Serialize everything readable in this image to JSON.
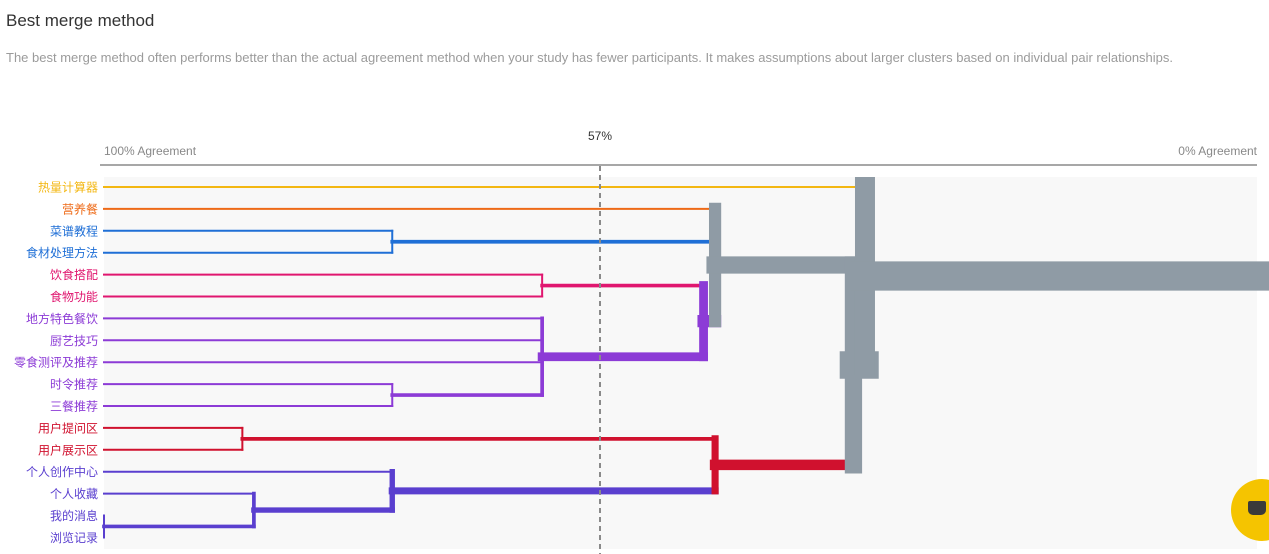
{
  "header": {
    "title": "Best merge method",
    "description": "The best merge method often performs better than the actual agreement method when your study has fewer participants. It makes assumptions about larger clusters based on individual pair relationships."
  },
  "chart_data": {
    "type": "dendrogram",
    "axis": {
      "left_label": "100% Agreement",
      "right_label": "0% Agreement"
    },
    "threshold": {
      "label": "57%",
      "value": 57
    },
    "leaves": [
      {
        "id": "L0",
        "label": "热量计算器",
        "color": "#f3b712"
      },
      {
        "id": "L1",
        "label": "营养餐",
        "color": "#ee6a17"
      },
      {
        "id": "L2",
        "label": "菜谱教程",
        "color": "#1f6fd6"
      },
      {
        "id": "L3",
        "label": "食材处理方法",
        "color": "#1f6fd6"
      },
      {
        "id": "L4",
        "label": "饮食搭配",
        "color": "#e0166f"
      },
      {
        "id": "L5",
        "label": "食物功能",
        "color": "#e0166f"
      },
      {
        "id": "L6",
        "label": "地方特色餐饮",
        "color": "#8c3bd6"
      },
      {
        "id": "L7",
        "label": "厨艺技巧",
        "color": "#8c3bd6"
      },
      {
        "id": "L8",
        "label": "零食测评及推荐",
        "color": "#8c3bd6"
      },
      {
        "id": "L9",
        "label": "时令推荐",
        "color": "#8c3bd6"
      },
      {
        "id": "L10",
        "label": "三餐推荐",
        "color": "#8c3bd6"
      },
      {
        "id": "L11",
        "label": "用户提问区",
        "color": "#d0112e"
      },
      {
        "id": "L12",
        "label": "用户展示区",
        "color": "#d0112e"
      },
      {
        "id": "L13",
        "label": "个人创作中心",
        "color": "#5a3fcf"
      },
      {
        "id": "L14",
        "label": "个人收藏",
        "color": "#5a3fcf"
      },
      {
        "id": "L15",
        "label": "我的消息",
        "color": "#5a3fcf"
      },
      {
        "id": "L16",
        "label": "浏览记录",
        "color": "#5a3fcf"
      }
    ],
    "merges": [
      {
        "id": "A",
        "children": [
          "L15",
          "L16"
        ],
        "agreement": 100,
        "color": "#5a3fcf"
      },
      {
        "id": "B",
        "children": [
          "L14",
          "A"
        ],
        "agreement": 87,
        "color": "#5a3fcf"
      },
      {
        "id": "C",
        "children": [
          "L13",
          "B"
        ],
        "agreement": 75,
        "color": "#5a3fcf"
      },
      {
        "id": "D",
        "children": [
          "L11",
          "L12"
        ],
        "agreement": 88,
        "color": "#d0112e"
      },
      {
        "id": "E",
        "children": [
          "D",
          "C"
        ],
        "agreement": 47,
        "color": "#d0112e"
      },
      {
        "id": "F",
        "children": [
          "L9",
          "L10"
        ],
        "agreement": 75,
        "color": "#8c3bd6"
      },
      {
        "id": "G",
        "children": [
          "L6",
          "L7",
          "L8",
          "F"
        ],
        "agreement": 62,
        "color": "#8c3bd6"
      },
      {
        "id": "H",
        "children": [
          "L4",
          "L5"
        ],
        "agreement": 62,
        "color": "#e0166f"
      },
      {
        "id": "I",
        "children": [
          "H",
          "G"
        ],
        "agreement": 48,
        "color": "#8c3bd6"
      },
      {
        "id": "J",
        "children": [
          "L2",
          "L3"
        ],
        "agreement": 75,
        "color": "#1f6fd6"
      },
      {
        "id": "K",
        "children": [
          "L1",
          "J",
          "I"
        ],
        "agreement": 47,
        "color": "#8f9ba5"
      },
      {
        "id": "M",
        "children": [
          "K",
          "E"
        ],
        "agreement": 35,
        "color": "#8f9ba5"
      },
      {
        "id": "N",
        "children": [
          "L0",
          "M"
        ],
        "agreement": 34,
        "color": "#8f9ba5"
      }
    ]
  }
}
